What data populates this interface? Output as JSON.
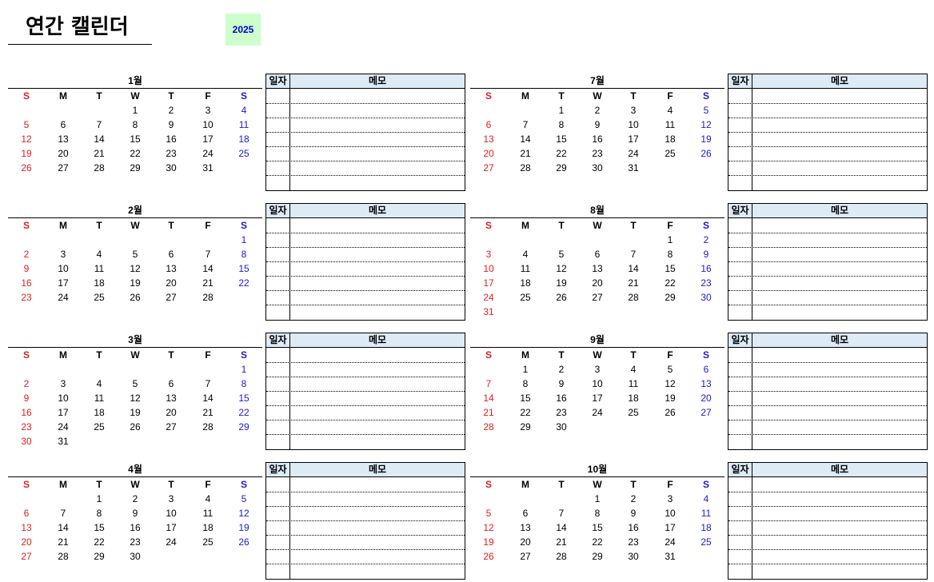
{
  "title": "연간 캘린더",
  "year": "2025",
  "weekdays": [
    "S",
    "M",
    "T",
    "W",
    "T",
    "F",
    "S"
  ],
  "memo_labels": {
    "date": "일자",
    "memo": "메모"
  },
  "colors": {
    "sunday": "#e02020",
    "saturday": "#1a1ad0",
    "memo_header_bg": "#ddebf7",
    "year_bg": "#ccffcc"
  },
  "months": [
    {
      "label": "1월",
      "rows": [
        [
          "",
          "",
          "",
          "1",
          "2",
          "3",
          "4"
        ],
        [
          "5",
          "6",
          "7",
          "8",
          "9",
          "10",
          "11"
        ],
        [
          "12",
          "13",
          "14",
          "15",
          "16",
          "17",
          "18"
        ],
        [
          "19",
          "20",
          "21",
          "22",
          "23",
          "24",
          "25"
        ],
        [
          "26",
          "27",
          "28",
          "29",
          "30",
          "31",
          ""
        ]
      ]
    },
    {
      "label": "2월",
      "rows": [
        [
          "",
          "",
          "",
          "",
          "",
          "",
          "1"
        ],
        [
          "2",
          "3",
          "4",
          "5",
          "6",
          "7",
          "8"
        ],
        [
          "9",
          "10",
          "11",
          "12",
          "13",
          "14",
          "15"
        ],
        [
          "16",
          "17",
          "18",
          "19",
          "20",
          "21",
          "22"
        ],
        [
          "23",
          "24",
          "25",
          "26",
          "27",
          "28",
          ""
        ]
      ]
    },
    {
      "label": "3월",
      "rows": [
        [
          "",
          "",
          "",
          "",
          "",
          "",
          "1"
        ],
        [
          "2",
          "3",
          "4",
          "5",
          "6",
          "7",
          "8"
        ],
        [
          "9",
          "10",
          "11",
          "12",
          "13",
          "14",
          "15"
        ],
        [
          "16",
          "17",
          "18",
          "19",
          "20",
          "21",
          "22"
        ],
        [
          "23",
          "24",
          "25",
          "26",
          "27",
          "28",
          "29"
        ],
        [
          "30",
          "31",
          "",
          "",
          "",
          "",
          ""
        ]
      ]
    },
    {
      "label": "4월",
      "rows": [
        [
          "",
          "",
          "1",
          "2",
          "3",
          "4",
          "5"
        ],
        [
          "6",
          "7",
          "8",
          "9",
          "10",
          "11",
          "12"
        ],
        [
          "13",
          "14",
          "15",
          "16",
          "17",
          "18",
          "19"
        ],
        [
          "20",
          "21",
          "22",
          "23",
          "24",
          "25",
          "26"
        ],
        [
          "27",
          "28",
          "29",
          "30",
          "",
          "",
          ""
        ]
      ]
    },
    {
      "label": "7월",
      "rows": [
        [
          "",
          "",
          "1",
          "2",
          "3",
          "4",
          "5"
        ],
        [
          "6",
          "7",
          "8",
          "9",
          "10",
          "11",
          "12"
        ],
        [
          "13",
          "14",
          "15",
          "16",
          "17",
          "18",
          "19"
        ],
        [
          "20",
          "21",
          "22",
          "23",
          "24",
          "25",
          "26"
        ],
        [
          "27",
          "28",
          "29",
          "30",
          "31",
          "",
          ""
        ]
      ]
    },
    {
      "label": "8월",
      "rows": [
        [
          "",
          "",
          "",
          "",
          "",
          "1",
          "2"
        ],
        [
          "3",
          "4",
          "5",
          "6",
          "7",
          "8",
          "9"
        ],
        [
          "10",
          "11",
          "12",
          "13",
          "14",
          "15",
          "16"
        ],
        [
          "17",
          "18",
          "19",
          "20",
          "21",
          "22",
          "23"
        ],
        [
          "24",
          "25",
          "26",
          "27",
          "28",
          "29",
          "30"
        ],
        [
          "31",
          "",
          "",
          "",
          "",
          "",
          ""
        ]
      ]
    },
    {
      "label": "9월",
      "rows": [
        [
          "",
          "1",
          "2",
          "3",
          "4",
          "5",
          "6"
        ],
        [
          "7",
          "8",
          "9",
          "10",
          "11",
          "12",
          "13"
        ],
        [
          "14",
          "15",
          "16",
          "17",
          "18",
          "19",
          "20"
        ],
        [
          "21",
          "22",
          "23",
          "24",
          "25",
          "26",
          "27"
        ],
        [
          "28",
          "29",
          "30",
          "",
          "",
          "",
          ""
        ]
      ]
    },
    {
      "label": "10월",
      "rows": [
        [
          "",
          "",
          "",
          "1",
          "2",
          "3",
          "4"
        ],
        [
          "5",
          "6",
          "7",
          "8",
          "9",
          "10",
          "11"
        ],
        [
          "12",
          "13",
          "14",
          "15",
          "16",
          "17",
          "18"
        ],
        [
          "19",
          "20",
          "21",
          "22",
          "23",
          "24",
          "25"
        ],
        [
          "26",
          "27",
          "28",
          "29",
          "30",
          "31",
          ""
        ]
      ]
    }
  ]
}
